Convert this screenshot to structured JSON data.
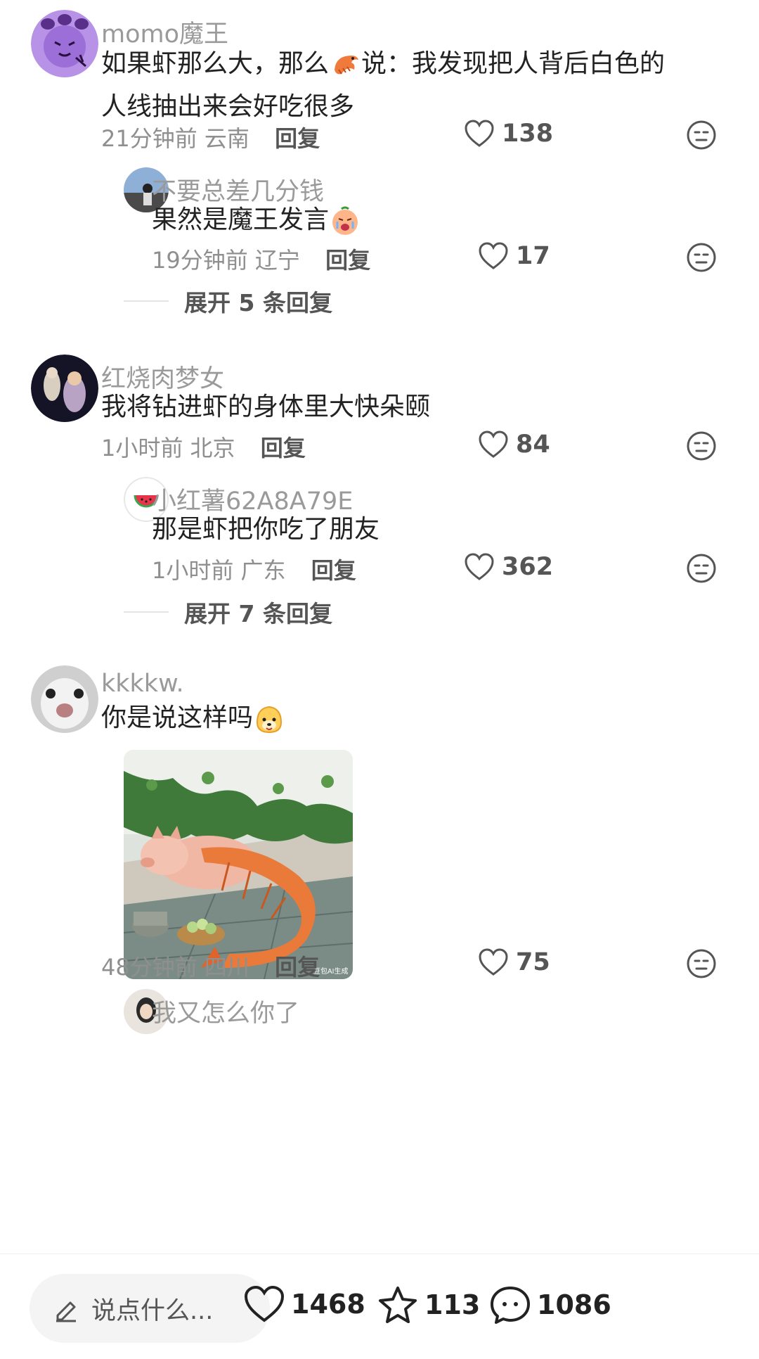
{
  "comments": [
    {
      "username": "momo魔王",
      "content_line1": "如果虾那么大，那么",
      "content_line1b": "说：我发现把人背后白色的",
      "content_line2": "人线抽出来会好吃很多",
      "time": "21分钟前",
      "location": "云南",
      "reply_label": "回复",
      "likes": "138",
      "reply": {
        "username": "不要总差几分钱",
        "content": "果然是魔王发言",
        "time": "19分钟前",
        "location": "辽宁",
        "reply_label": "回复",
        "likes": "17"
      },
      "expand": "展开 5 条回复"
    },
    {
      "username": "红烧肉梦女",
      "content": "我将钻进虾的身体里大快朵颐",
      "time": "1小时前",
      "location": "北京",
      "reply_label": "回复",
      "likes": "84",
      "reply": {
        "username": "小红薯62A8A79E",
        "content": "那是虾把你吃了朋友",
        "time": "1小时前",
        "location": "广东",
        "reply_label": "回复",
        "likes": "362"
      },
      "expand": "展开 7 条回复"
    },
    {
      "username": "kkkkw.",
      "content": "你是说这样吗",
      "image_watermark": "豆包AI生成",
      "time": "48分钟前",
      "location": "四川",
      "reply_label": "回复",
      "likes": "75",
      "next_reply_username": "我又怎么你了"
    }
  ],
  "bottom_bar": {
    "input_placeholder": "说点什么...",
    "likes": "1468",
    "stars": "113",
    "comments": "1086"
  },
  "colors": {
    "username": "#9a9a9a",
    "text": "#222222",
    "meta": "#8f8f8f"
  }
}
